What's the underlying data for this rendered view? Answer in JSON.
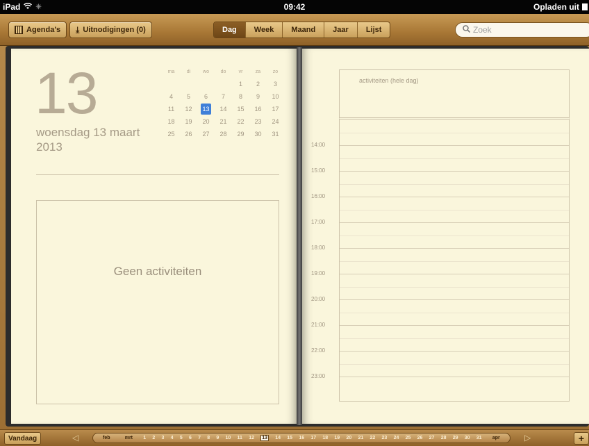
{
  "status": {
    "device": "iPad",
    "time": "09:42",
    "battery_text": "Opladen uit"
  },
  "toolbar": {
    "agendas_label": "Agenda's",
    "invites_label": "Uitnodigingen (0)",
    "views": [
      "Dag",
      "Week",
      "Maand",
      "Jaar",
      "Lijst"
    ],
    "active_view": "Dag",
    "search_placeholder": "Zoek"
  },
  "day": {
    "number": "13",
    "weekday_date": "woensdag 13 maart",
    "year": "2013",
    "empty_text": "Geen activiteiten"
  },
  "mini_calendar": {
    "weekdays": [
      "ma",
      "di",
      "wo",
      "do",
      "vr",
      "za",
      "zo"
    ],
    "weeks": [
      [
        "",
        "",
        "",
        "",
        "1",
        "2",
        "3"
      ],
      [
        "4",
        "5",
        "6",
        "7",
        "8",
        "9",
        "10"
      ],
      [
        "11",
        "12",
        "13",
        "14",
        "15",
        "16",
        "17"
      ],
      [
        "18",
        "19",
        "20",
        "21",
        "22",
        "23",
        "24"
      ],
      [
        "25",
        "26",
        "27",
        "28",
        "29",
        "30",
        "31"
      ]
    ],
    "selected": "13"
  },
  "day_view": {
    "all_day_label": "activiteiten (hele dag)",
    "hours": [
      "14:00",
      "15:00",
      "16:00",
      "17:00",
      "18:00",
      "19:00",
      "20:00",
      "21:00",
      "22:00",
      "23:00"
    ]
  },
  "bottombar": {
    "today_label": "Vandaag",
    "prev_month": "feb",
    "current_month": "mrt",
    "next_month": "apr",
    "days": [
      "1",
      "2",
      "3",
      "4",
      "5",
      "6",
      "7",
      "8",
      "9",
      "10",
      "11",
      "12",
      "13",
      "14",
      "15",
      "16",
      "17",
      "18",
      "19",
      "20",
      "21",
      "22",
      "23",
      "24",
      "25",
      "26",
      "27",
      "28",
      "29",
      "30",
      "31"
    ],
    "selected_day": "13",
    "add_label": "+"
  }
}
